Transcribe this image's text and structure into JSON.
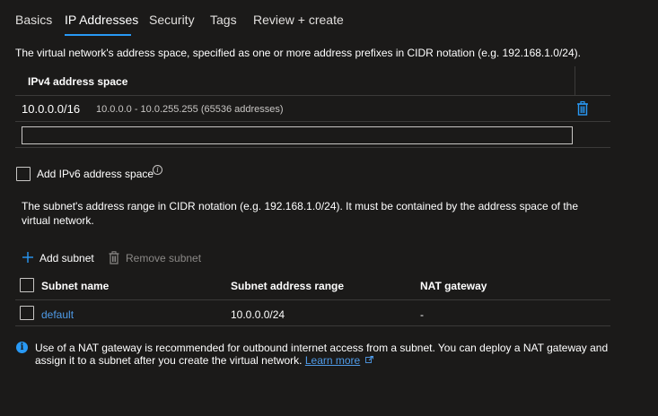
{
  "tabs": [
    {
      "label": "Basics",
      "active": false
    },
    {
      "label": "IP Addresses",
      "active": true
    },
    {
      "label": "Security",
      "active": false
    },
    {
      "label": "Tags",
      "active": false
    },
    {
      "label": "Review + create",
      "active": false
    }
  ],
  "address_space": {
    "description": "The virtual network's address space, specified as one or more address prefixes in CIDR notation (e.g. 192.168.1.0/24).",
    "column_header": "IPv4 address space",
    "rows": [
      {
        "cidr": "10.0.0.0/16",
        "range": "10.0.0.0 - 10.0.255.255 (65536 addresses)"
      }
    ],
    "new_entry_value": ""
  },
  "ipv6": {
    "label": "Add IPv6 address space",
    "checked": false
  },
  "subnet": {
    "description": "The subnet's address range in CIDR notation (e.g. 192.168.1.0/24). It must be contained by the address space of the virtual network.",
    "add_label": "Add subnet",
    "remove_label": "Remove subnet",
    "columns": [
      "Subnet name",
      "Subnet address range",
      "NAT gateway"
    ],
    "rows": [
      {
        "name": "default",
        "range": "10.0.0.0/24",
        "nat": "-"
      }
    ]
  },
  "nat_note": {
    "text": "Use of a NAT gateway is recommended for outbound internet access from a subnet. You can deploy a NAT gateway and assign it to a subnet after you create the virtual network.",
    "link": "Learn more"
  },
  "colors": {
    "background": "#1b1a19",
    "accent": "#2899f5",
    "link": "#4f9be8",
    "border": "#3b3a39"
  }
}
